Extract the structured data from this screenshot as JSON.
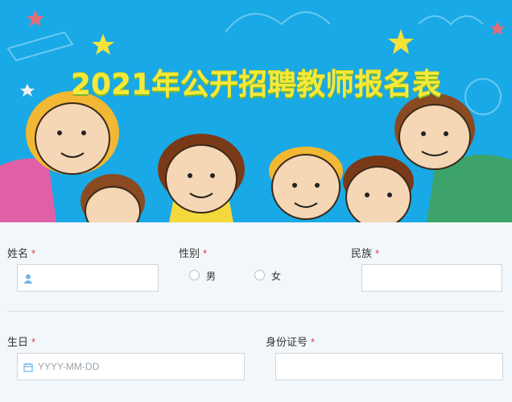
{
  "banner": {
    "title": "2021年公开招聘教师报名表"
  },
  "form": {
    "name": {
      "label": "姓名",
      "required": "*",
      "icon": "user-icon"
    },
    "gender": {
      "label": "性别",
      "required": "*",
      "options": [
        "男",
        "女"
      ]
    },
    "ethnicity": {
      "label": "民族",
      "required": "*"
    },
    "birthday": {
      "label": "生日",
      "required": "*",
      "placeholder": "YYYY-MM-DD",
      "icon": "calendar-icon"
    },
    "id_number": {
      "label": "身份证号",
      "required": "*"
    }
  },
  "colors": {
    "banner_bg": "#19a9e6",
    "title": "#f5e93a",
    "required": "#e23b3b",
    "form_bg": "#f2f7fb"
  }
}
